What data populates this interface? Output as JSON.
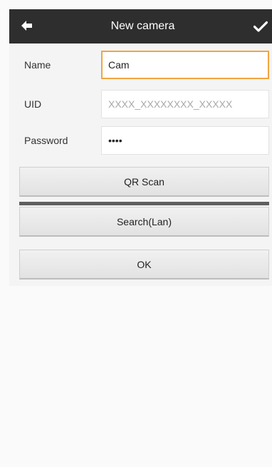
{
  "header": {
    "title": "New camera",
    "back_icon": "back-arrow-icon",
    "confirm_icon": "checkmark-icon"
  },
  "form": {
    "name": {
      "label": "Name",
      "value": "Cam",
      "placeholder": ""
    },
    "uid": {
      "label": "UID",
      "value": "",
      "placeholder": "XXXX_XXXXXXXX_XXXXX"
    },
    "password": {
      "label": "Password",
      "value": "1234",
      "placeholder": ""
    }
  },
  "buttons": {
    "qr_scan": "QR Scan",
    "search_lan": "Search(Lan)",
    "ok": "OK"
  },
  "colors": {
    "header_bg": "#2e2e2e",
    "focus_border": "#f0a640",
    "panel_bg": "#f4f4f4"
  }
}
